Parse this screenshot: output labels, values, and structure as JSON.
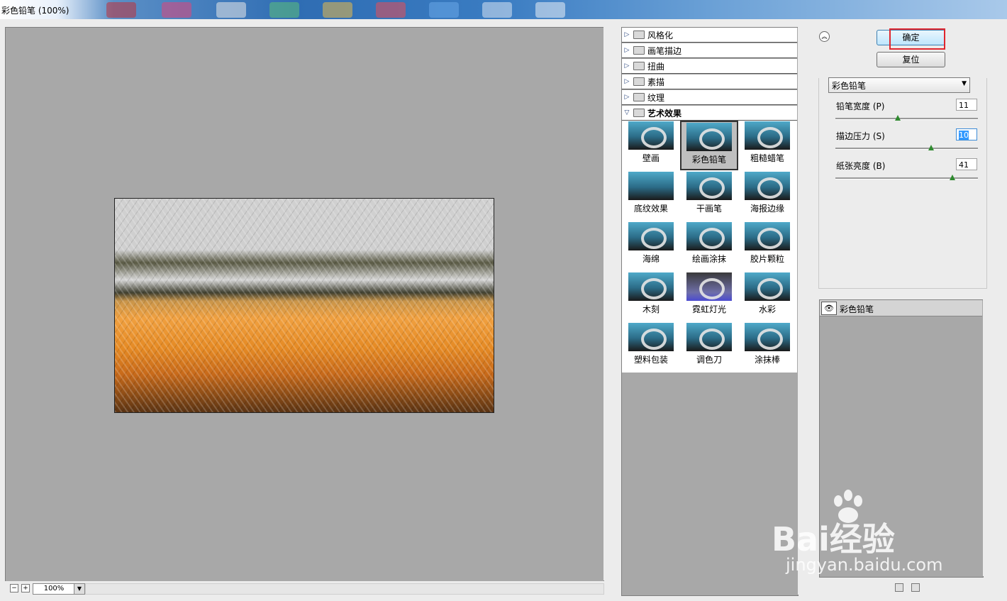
{
  "window": {
    "title": "彩色铅笔 (100%)"
  },
  "preview": {
    "zoom": "100%",
    "zoom_out": "−",
    "zoom_in": "+"
  },
  "filter_browser": {
    "categories": [
      {
        "label": "风格化",
        "expanded": false
      },
      {
        "label": "画笔描边",
        "expanded": false
      },
      {
        "label": "扭曲",
        "expanded": false
      },
      {
        "label": "素描",
        "expanded": false
      },
      {
        "label": "纹理",
        "expanded": false
      },
      {
        "label": "艺术效果",
        "expanded": true
      }
    ],
    "thumbnails": [
      {
        "label": "壁画"
      },
      {
        "label": "彩色铅笔"
      },
      {
        "label": "粗糙蜡笔"
      },
      {
        "label": "底纹效果"
      },
      {
        "label": "干画笔"
      },
      {
        "label": "海报边缘"
      },
      {
        "label": "海绵"
      },
      {
        "label": "绘画涂抹"
      },
      {
        "label": "胶片颗粒"
      },
      {
        "label": "木刻"
      },
      {
        "label": "霓虹灯光"
      },
      {
        "label": "水彩"
      },
      {
        "label": "塑料包装"
      },
      {
        "label": "调色刀"
      },
      {
        "label": "涂抹棒"
      }
    ],
    "selected": "彩色铅笔"
  },
  "controls": {
    "ok_label": "确定",
    "reset_label": "复位",
    "filter_select": "彩色铅笔",
    "params": [
      {
        "label": "铅笔宽度 (P)",
        "value": "11",
        "level": 0.44
      },
      {
        "label": "描边压力 (S)",
        "value": "10",
        "level": 0.67
      },
      {
        "label": "纸张亮度 (B)",
        "value": "41",
        "level": 0.82
      }
    ]
  },
  "layers": {
    "items": [
      {
        "label": "彩色铅笔"
      }
    ]
  },
  "watermark": {
    "brand": "Bai经验",
    "url": "jingyan.baidu.com"
  },
  "colors": {
    "highlight": "#e0262e",
    "panel_gray": "#a8a8a8"
  }
}
